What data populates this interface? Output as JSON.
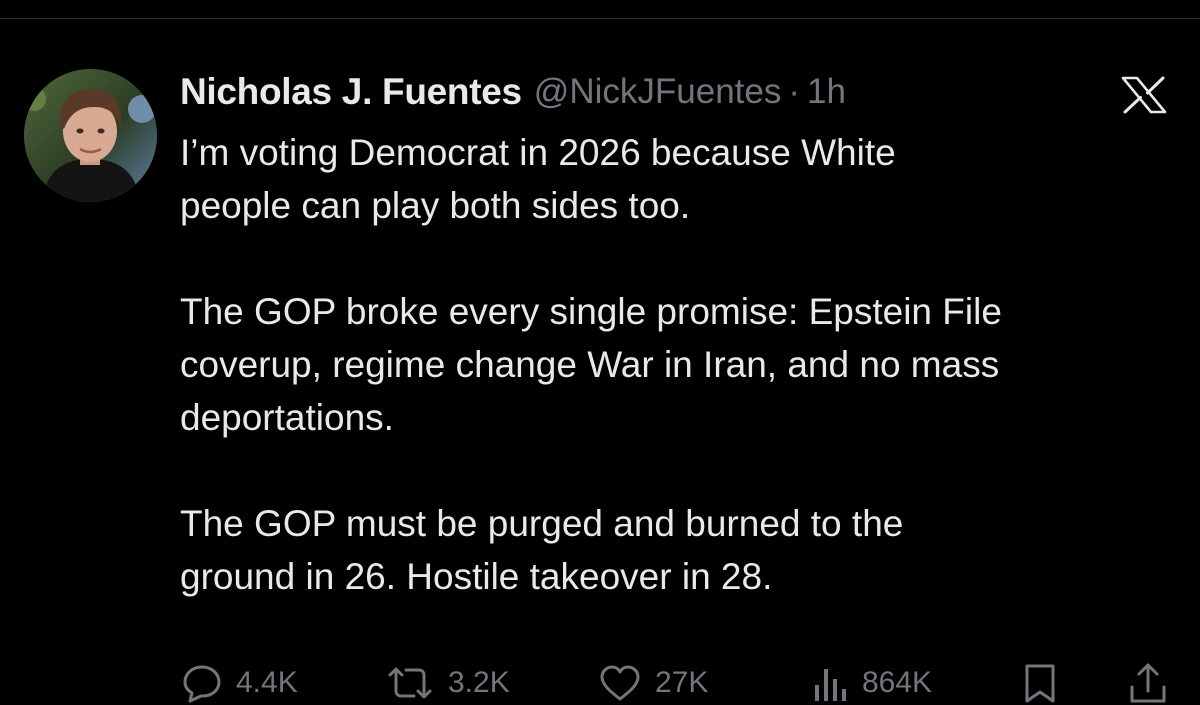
{
  "tweet": {
    "author": {
      "display_name": "Nicholas J. Fuentes",
      "handle": "@NickJFuentes",
      "separator": "·",
      "time": "1h"
    },
    "paragraphs": [
      "I’m voting Democrat in 2026 because White\npeople can play both sides too.",
      "The GOP broke every single promise: Epstein File\ncoverup, regime change War in Iran, and no mass\ndeportations.",
      "The GOP must be purged and burned to the\nground in 26. Hostile takeover in 28."
    ],
    "metrics": {
      "replies": "4.4K",
      "reposts": "3.2K",
      "likes": "27K",
      "views": "864K"
    }
  },
  "icons": {
    "platform_logo": "x-logo-icon",
    "reply": "reply-bubble-icon",
    "repost": "repost-arrows-icon",
    "like": "heart-icon",
    "views": "views-bar-chart-icon",
    "bookmark": "bookmark-icon",
    "share": "share-upload-icon"
  },
  "colors": {
    "background": "#000000",
    "primary_text": "#e7e9ea",
    "secondary_text": "#71767b",
    "divider": "#2f3336"
  }
}
